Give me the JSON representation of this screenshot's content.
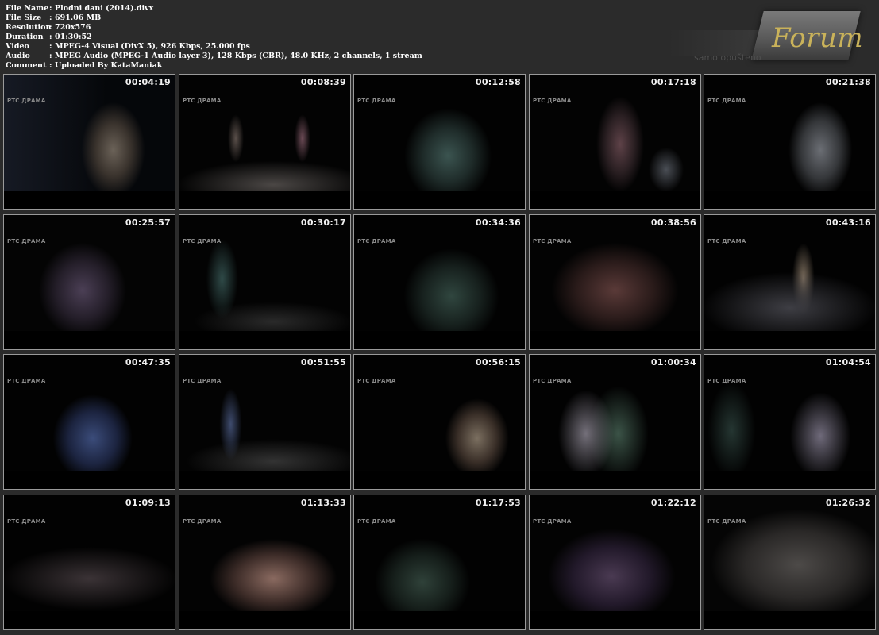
{
  "file_info": [
    {
      "key": "File Name",
      "value": "Plodni dani (2014).divx"
    },
    {
      "key": "File Size",
      "value": "691.06 MB"
    },
    {
      "key": "Resolution",
      "value": "720x576"
    },
    {
      "key": "Duration",
      "value": "01:30:52"
    },
    {
      "key": "Video",
      "value": "MPEG-4 Visual (DivX 5), 926 Kbps, 25.000 fps"
    },
    {
      "key": "Audio",
      "value": "MPEG Audio (MPEG-1 Audio layer 3), 128 Kbps (CBR), 48.0 KHz, 2 channels, 1 stream"
    },
    {
      "key": "Comment",
      "value": "Uploaded By KataManiak"
    }
  ],
  "separator": ":",
  "logo": {
    "title": "Forum",
    "subtitle": "samo opušteno"
  },
  "channel_logo": "РТС ДРАМА",
  "thumbnails": [
    {
      "timestamp": "00:04:19"
    },
    {
      "timestamp": "00:08:39"
    },
    {
      "timestamp": "00:12:58"
    },
    {
      "timestamp": "00:17:18"
    },
    {
      "timestamp": "00:21:38"
    },
    {
      "timestamp": "00:25:57"
    },
    {
      "timestamp": "00:30:17"
    },
    {
      "timestamp": "00:34:36"
    },
    {
      "timestamp": "00:38:56"
    },
    {
      "timestamp": "00:43:16"
    },
    {
      "timestamp": "00:47:35"
    },
    {
      "timestamp": "00:51:55"
    },
    {
      "timestamp": "00:56:15"
    },
    {
      "timestamp": "01:00:34"
    },
    {
      "timestamp": "01:04:54"
    },
    {
      "timestamp": "01:09:13"
    },
    {
      "timestamp": "01:13:33"
    },
    {
      "timestamp": "01:17:53"
    },
    {
      "timestamp": "01:22:12"
    },
    {
      "timestamp": "01:26:32"
    }
  ],
  "colors": {
    "background": "#2b2b2b",
    "thumb_border": "#9a9a9a",
    "logo_accent": "#c9b25a"
  }
}
